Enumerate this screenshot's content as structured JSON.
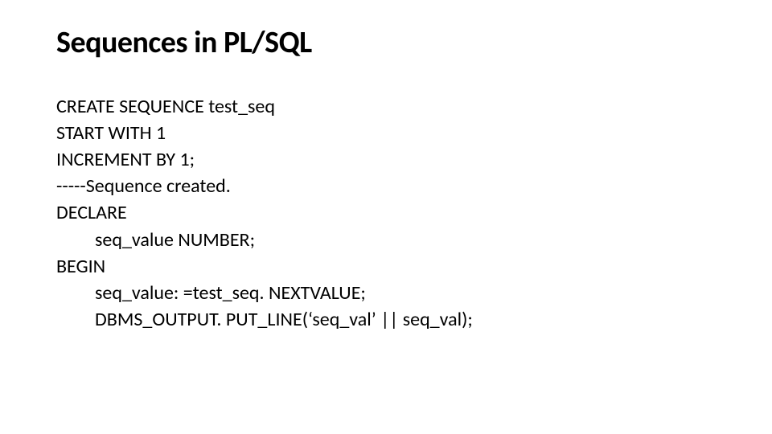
{
  "slide": {
    "title": "Sequences in PL/SQL",
    "code": {
      "line1": "CREATE SEQUENCE test_seq",
      "line2": "START WITH 1",
      "line3": "INCREMENT BY 1;",
      "line4": "-----Sequence created.",
      "line5": "DECLARE",
      "line6": "seq_value NUMBER;",
      "line7": "BEGIN",
      "line8": "seq_value: =test_seq. NEXTVALUE;",
      "line9": "DBMS_OUTPUT. PUT_LINE(‘seq_val’ || seq_val);"
    }
  }
}
